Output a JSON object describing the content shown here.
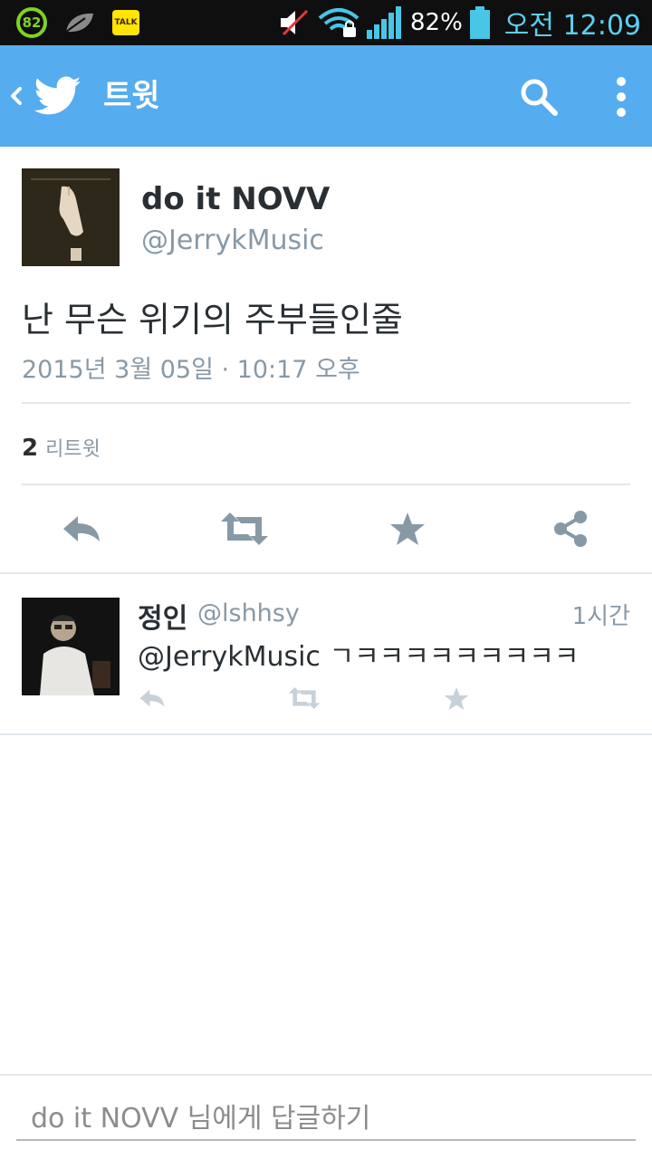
{
  "status_bar": {
    "battery_ring": "82",
    "talk_label": "TALK",
    "battery_percent": "82%",
    "clock": "오전 12:09",
    "icons": [
      "battery-ring-icon",
      "leaf-icon",
      "kakaotalk-icon",
      "mute-icon",
      "wifi-icon",
      "signal-icon",
      "battery-icon"
    ]
  },
  "app_bar": {
    "title": "트윗",
    "icons": [
      "back-icon",
      "twitter-bird-icon",
      "search-icon",
      "more-icon"
    ],
    "color": "#55acee"
  },
  "tweet": {
    "name": "do it NOVV",
    "handle": "@JerrykMusic",
    "text": "난 무슨 위기의 주부들인줄",
    "timestamp": "2015년 3월 05일 · 10:17 오후",
    "retweet_count": "2",
    "retweet_label": "리트윗",
    "actions": [
      "reply-icon",
      "retweet-icon",
      "favorite-icon",
      "share-icon"
    ]
  },
  "reply": {
    "name": "정인",
    "handle": "@lshhsy",
    "time": "1시간",
    "text": "@JerrykMusic ㄱㅋㅋㅋㅋㅋㅋㅋㅋㅋ",
    "actions": [
      "reply-icon",
      "retweet-icon",
      "favorite-icon"
    ]
  },
  "composer": {
    "placeholder": "do it NOVV 님에게 답글하기"
  }
}
